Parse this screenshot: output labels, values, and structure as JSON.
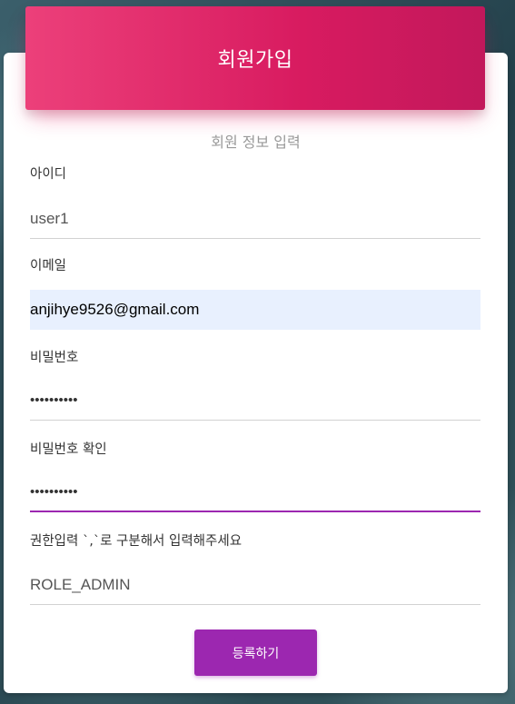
{
  "header": {
    "title": "회원가입"
  },
  "form": {
    "subtitle": "회원 정보 입력",
    "fields": [
      {
        "label": "아이디",
        "value": "user1"
      },
      {
        "label": "이메일",
        "value": "anjihye9526@gmail.com"
      },
      {
        "label": "비밀번호",
        "value": "••••••••••"
      },
      {
        "label": "비밀번호 확인",
        "value": "••••••••••"
      },
      {
        "label": "권한입력 `,`로 구분해서 입력해주세요",
        "value": "ROLE_ADMIN"
      }
    ],
    "submit_label": "등록하기"
  },
  "colors": {
    "header_gradient_start": "#ec407a",
    "header_gradient_end": "#c2185b",
    "accent": "#9c27b0",
    "autofill_bg": "#e8f0fe"
  }
}
